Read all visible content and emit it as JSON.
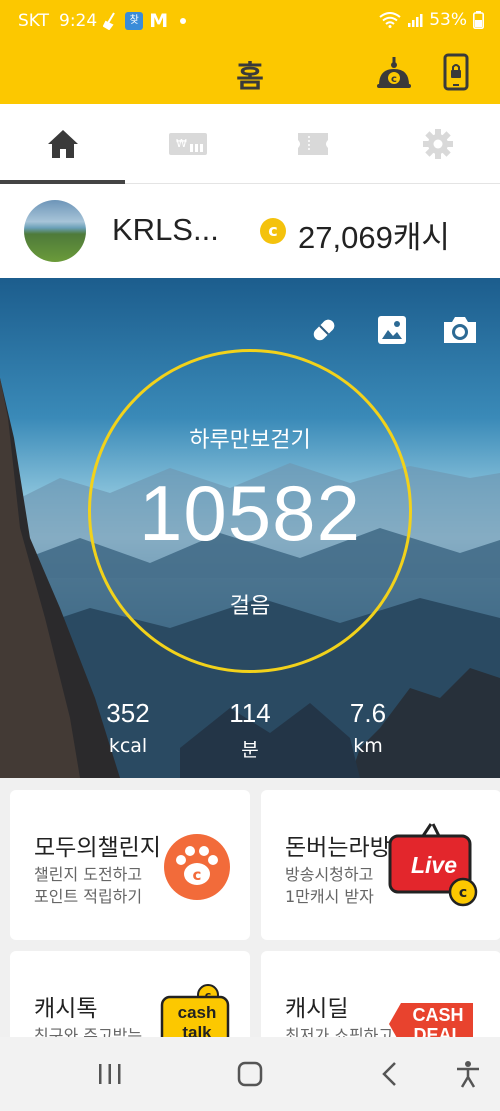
{
  "status_bar": {
    "carrier": "SKT",
    "time": "9:24",
    "notif_badge": "찾",
    "notif_m": "M",
    "battery": "53%"
  },
  "header": {
    "title": "홈"
  },
  "tabs": [
    {
      "name": "home",
      "icon": "home-icon",
      "active": true
    },
    {
      "name": "cash-shop",
      "icon": "cash-card-icon",
      "active": false
    },
    {
      "name": "ticket",
      "icon": "ticket-icon",
      "active": false
    },
    {
      "name": "settings",
      "icon": "gear-icon",
      "active": false
    }
  ],
  "profile": {
    "nickname": "KRLS...",
    "coin_symbol": "c",
    "cash_amount": "27,069캐시"
  },
  "pedometer": {
    "label": "하루만보걷기",
    "steps": "10582",
    "unit": "걸음",
    "stats": [
      {
        "value": "352",
        "unit": "kcal"
      },
      {
        "value": "114",
        "unit": "분"
      },
      {
        "value": "7.6",
        "unit": "km"
      }
    ]
  },
  "cards": [
    {
      "title": "모두의챌린지",
      "line1": "챌린지 도전하고",
      "line2": "포인트 적립하기"
    },
    {
      "title": "돈버는라방",
      "line1": "방송시청하고",
      "line2": "1만캐시 받자",
      "badge": "Live"
    },
    {
      "title": "캐시톡",
      "line1": "친구와 주고받는",
      "badge1": "cash",
      "badge2": "talk"
    },
    {
      "title": "캐시딜",
      "line1": "최저가 쇼핑하고",
      "badge1": "CASH",
      "badge2": "DEAL"
    }
  ],
  "colors": {
    "brand_yellow": "#fcc800",
    "ring_yellow": "#f2d21b",
    "challenge_orange": "#f26b3a",
    "live_red": "#e3262c"
  }
}
